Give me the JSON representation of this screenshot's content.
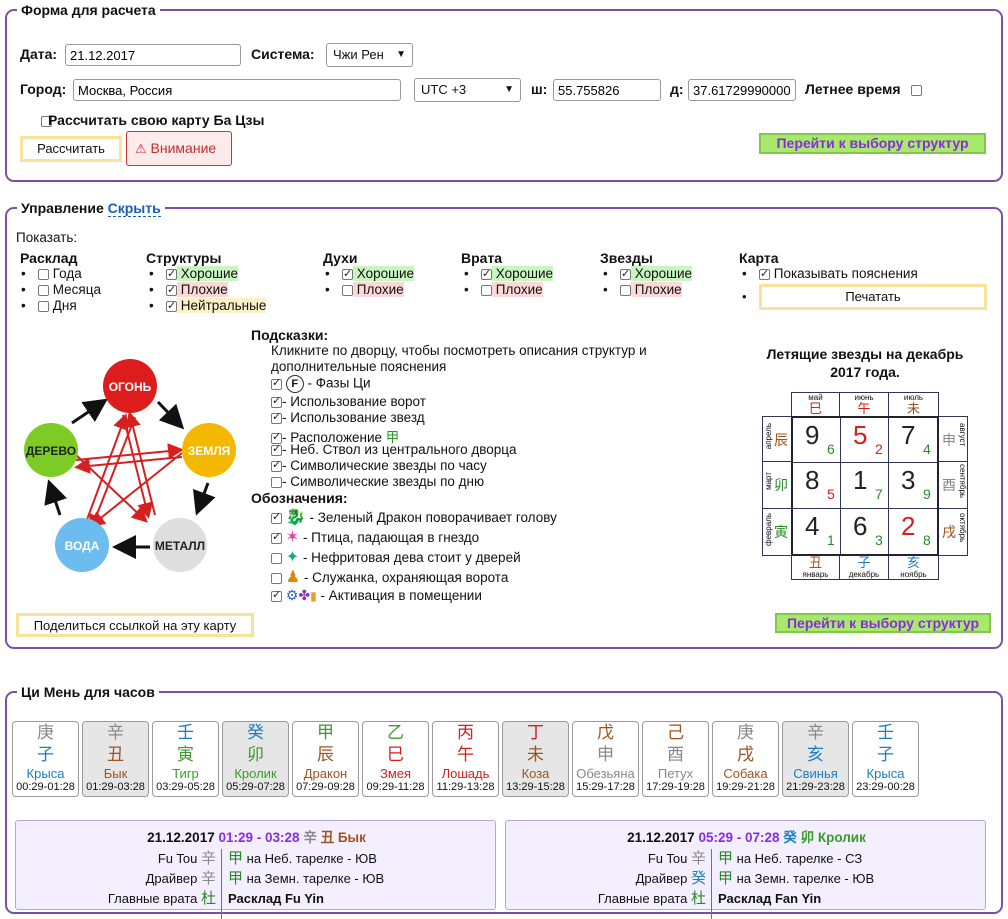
{
  "form": {
    "legend": "Форма для расчета",
    "date_label": "Дата:",
    "date_value": "21.12.2017",
    "system_label": "Система:",
    "system_value": "Чжи Рен",
    "city_label": "Город:",
    "city_value": "Москва, Россия",
    "tz_value": "UTC +3",
    "lat_label": "ш:",
    "lat_value": "55.755826",
    "lon_label": "д:",
    "lon_value": "37.61729990000",
    "summer_label": "Летнее время",
    "own_card_label": "Рассчитать свою карту Ба Цзы",
    "calc_button": "Рассчитать",
    "warning_button": "Внимание",
    "structures_button": "Перейти к выбору структур"
  },
  "control": {
    "legend": "Управление",
    "hide_link": "Скрыть",
    "show_label": "Показать:",
    "groups": {
      "layout": {
        "title": "Расклад",
        "items": [
          "Года",
          "Месяца",
          "Дня"
        ]
      },
      "structures": {
        "title": "Структуры",
        "items": [
          "Хорошие",
          "Плохие",
          "Нейтральные"
        ]
      },
      "spirits": {
        "title": "Духи",
        "items": [
          "Хорошие",
          "Плохие"
        ]
      },
      "gates": {
        "title": "Врата",
        "items": [
          "Хорошие",
          "Плохие"
        ]
      },
      "stars": {
        "title": "Звезды",
        "items": [
          "Хорошие",
          "Плохие"
        ]
      },
      "card": {
        "title": "Карта",
        "items": [
          "Показывать пояснения"
        ],
        "print_button": "Печатать"
      }
    },
    "hints_title": "Подсказки:",
    "hints_text": "Кликните по дворцу, чтобы посмотреть описания структур и дополнительные пояснения",
    "hints": [
      {
        "text": "- Фазы Ци",
        "checked": true,
        "badge": "F"
      },
      {
        "text": "- Использование ворот",
        "checked": true
      },
      {
        "text": "- Использование звезд",
        "checked": true
      },
      {
        "text": "- Расположение",
        "checked": true,
        "glyph": "甲"
      },
      {
        "text": "- Неб. Ствол из центрального дворца",
        "checked": true
      },
      {
        "text": "- Символические звезды по часу",
        "checked": true
      },
      {
        "text": "- Символические звезды по дню",
        "checked": false
      }
    ],
    "legend_title": "Обозначения:",
    "legend_items": [
      {
        "text": "- Зеленый Дракон поворачивает голову",
        "checked": true,
        "icon": "dragon-icon"
      },
      {
        "text": "- Птица, падающая в гнездо",
        "checked": true,
        "icon": "bird-icon"
      },
      {
        "text": "- Нефритовая дева стоит у дверей",
        "checked": false,
        "icon": "jade-maiden-icon"
      },
      {
        "text": "- Служанка, охраняющая ворота",
        "checked": false,
        "icon": "servant-icon"
      },
      {
        "text": "- Активация в помещении",
        "checked": true,
        "icon": "activation-icon"
      }
    ],
    "share_button": "Поделиться ссылкой на эту карту",
    "structures_button": "Перейти к выбору структур"
  },
  "elements": {
    "fire": "ОГОНЬ",
    "earth": "ЗЕМЛЯ",
    "metal": "МЕТАЛЛ",
    "water": "ВОДА",
    "wood": "ДЕРЕВО",
    "colors": {
      "fire": "#dd1c1c",
      "earth": "#f5b800",
      "metal": "#dedede",
      "water": "#6cbcef",
      "wood": "#7dcc26"
    }
  },
  "flying_stars": {
    "title": "Летящие звезды на декабрь 2017 года.",
    "top": [
      {
        "month": "май",
        "branch": "巳"
      },
      {
        "month": "июнь",
        "branch": "午"
      },
      {
        "month": "июль",
        "branch": "未"
      }
    ],
    "bottom": [
      {
        "month": "январь",
        "branch": "丑"
      },
      {
        "month": "декабрь",
        "branch": "子"
      },
      {
        "month": "ноябрь",
        "branch": "亥"
      }
    ],
    "left": [
      {
        "month": "апрель",
        "branch": "辰"
      },
      {
        "month": "март",
        "branch": "卯"
      },
      {
        "month": "февраль",
        "branch": "寅"
      }
    ],
    "right": [
      {
        "month": "август",
        "branch": "申"
      },
      {
        "month": "сентябрь",
        "branch": "酉"
      },
      {
        "month": "октябрь",
        "branch": "戌"
      }
    ],
    "cells": [
      {
        "big": "9",
        "small": "6"
      },
      {
        "big": "5",
        "small": "2"
      },
      {
        "big": "7",
        "small": "4"
      },
      {
        "big": "8",
        "small": "5"
      },
      {
        "big": "1",
        "small": "7"
      },
      {
        "big": "3",
        "small": "9"
      },
      {
        "big": "4",
        "small": "1"
      },
      {
        "big": "6",
        "small": "3"
      },
      {
        "big": "2",
        "small": "8"
      }
    ]
  },
  "hours": {
    "legend": "Ци Мень для часов",
    "cards": [
      {
        "stem": "庚",
        "branch": "子",
        "animal": "Крыса",
        "time": "00:29-01:28",
        "gray": false,
        "c1": "#888888",
        "c2": "#1a7fc0"
      },
      {
        "stem": "辛",
        "branch": "丑",
        "animal": "Бык",
        "time": "01:29-03:28",
        "gray": true,
        "c1": "#888888",
        "c2": "#a0521e"
      },
      {
        "stem": "壬",
        "branch": "寅",
        "animal": "Тигр",
        "time": "03:29-05:28",
        "gray": false,
        "c1": "#1a7fc0",
        "c2": "#3a9a2a"
      },
      {
        "stem": "癸",
        "branch": "卯",
        "animal": "Кролик",
        "time": "05:29-07:28",
        "gray": true,
        "c1": "#1a7fc0",
        "c2": "#3a9a2a"
      },
      {
        "stem": "甲",
        "branch": "辰",
        "animal": "Дракон",
        "time": "07:29-09:28",
        "gray": false,
        "c1": "#3a9a2a",
        "c2": "#a0521e"
      },
      {
        "stem": "乙",
        "branch": "巳",
        "animal": "Змея",
        "time": "09:29-11:28",
        "gray": false,
        "c1": "#3a9a2a",
        "c2": "#d41f1f"
      },
      {
        "stem": "丙",
        "branch": "午",
        "animal": "Лошадь",
        "time": "11:29-13:28",
        "gray": false,
        "c1": "#d41f1f",
        "c2": "#d41f1f"
      },
      {
        "stem": "丁",
        "branch": "未",
        "animal": "Коза",
        "time": "13:29-15:28",
        "gray": true,
        "c1": "#d41f1f",
        "c2": "#a0521e"
      },
      {
        "stem": "戊",
        "branch": "申",
        "animal": "Обезьяна",
        "time": "15:29-17:28",
        "gray": false,
        "c1": "#a0521e",
        "c2": "#888888"
      },
      {
        "stem": "己",
        "branch": "酉",
        "animal": "Петух",
        "time": "17:29-19:28",
        "gray": false,
        "c1": "#a0521e",
        "c2": "#888888"
      },
      {
        "stem": "庚",
        "branch": "戌",
        "animal": "Собака",
        "time": "19:29-21:28",
        "gray": false,
        "c1": "#888888",
        "c2": "#a0521e"
      },
      {
        "stem": "辛",
        "branch": "亥",
        "animal": "Свинья",
        "time": "21:29-23:28",
        "gray": true,
        "c1": "#888888",
        "c2": "#1a7fc0"
      },
      {
        "stem": "壬",
        "branch": "子",
        "animal": "Крыса",
        "time": "23:29-00:28",
        "gray": false,
        "c1": "#1a7fc0",
        "c2": "#1a7fc0"
      }
    ]
  },
  "day_panels": [
    {
      "date": "21.12.2017",
      "time": "01:29 - 03:28",
      "stem": "辛",
      "branch": "丑",
      "animal": "Бык",
      "fu_tou_label": "Fu Tou",
      "fu_tou_glyph": "辛",
      "driver_label": "Драйвер",
      "driver_glyph": "辛",
      "main_gate_label": "Главные врата",
      "main_gate_glyph": "杜",
      "plate1_glyph": "甲",
      "plate1_text": "на Неб. тарелке - ЮВ",
      "plate2_glyph": "甲",
      "plate2_text": "на Земн. тарелке - ЮВ",
      "layout_text": "Расклад Fu Yin"
    },
    {
      "date": "21.12.2017",
      "time": "05:29 - 07:28",
      "stem": "癸",
      "branch": "卯",
      "animal": "Кролик",
      "fu_tou_label": "Fu Tou",
      "fu_tou_glyph": "辛",
      "driver_label": "Драйвер",
      "driver_glyph": "癸",
      "main_gate_label": "Главные врата",
      "main_gate_glyph": "杜",
      "plate1_glyph": "甲",
      "plate1_text": "на Неб. тарелке - СЗ",
      "plate2_glyph": "甲",
      "plate2_text": "на Земн. тарелке - ЮВ",
      "layout_text": "Расклад Fan Yin"
    }
  ]
}
